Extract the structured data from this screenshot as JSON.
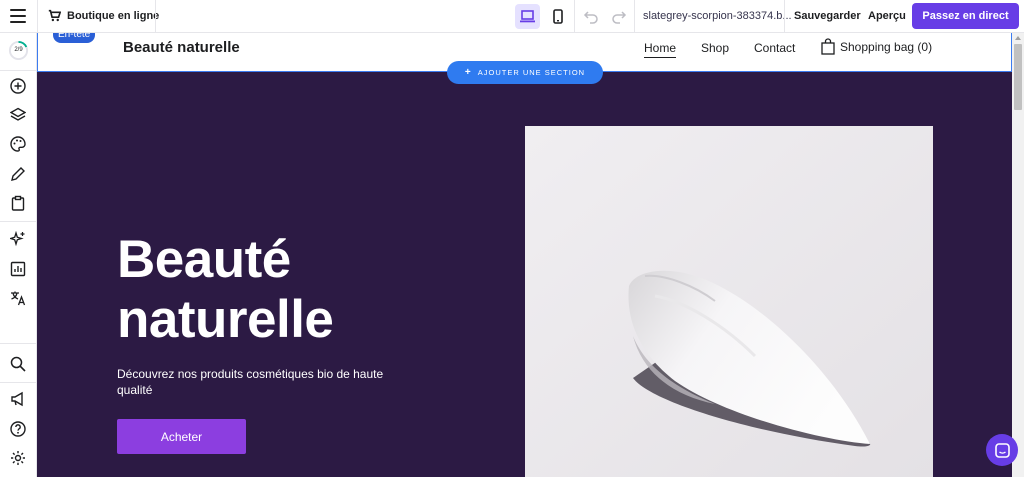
{
  "topbar": {
    "store_name": "Boutique en ligne",
    "url": "slategrey-scorpion-383374.b...",
    "save_label": "Sauvegarder",
    "preview_label": "Aperçu",
    "publish_label": "Passez en direct",
    "accent": "#673de6"
  },
  "sidebar": {
    "progress_label": "2/9",
    "items": [
      "add-icon",
      "layers-icon",
      "palette-icon",
      "pen-icon",
      "clipboard-icon",
      "sparkle-icon",
      "analytics-icon",
      "translate-icon",
      "search-icon",
      "megaphone-icon",
      "help-icon",
      "settings-icon"
    ]
  },
  "canvas": {
    "header_tag": "En-tête",
    "brand": "Beauté naturelle",
    "nav": [
      "Home",
      "Shop",
      "Contact"
    ],
    "bag_label": "Shopping bag (0)",
    "add_section_label": "AJOUTER UNE SECTION"
  },
  "hero": {
    "title": "Beauté naturelle",
    "subtitle": "Découvrez nos produits cosmétiques bio de haute qualité",
    "cta_label": "Acheter",
    "background": "#2c1a44",
    "cta_color": "#8c3ee0"
  }
}
